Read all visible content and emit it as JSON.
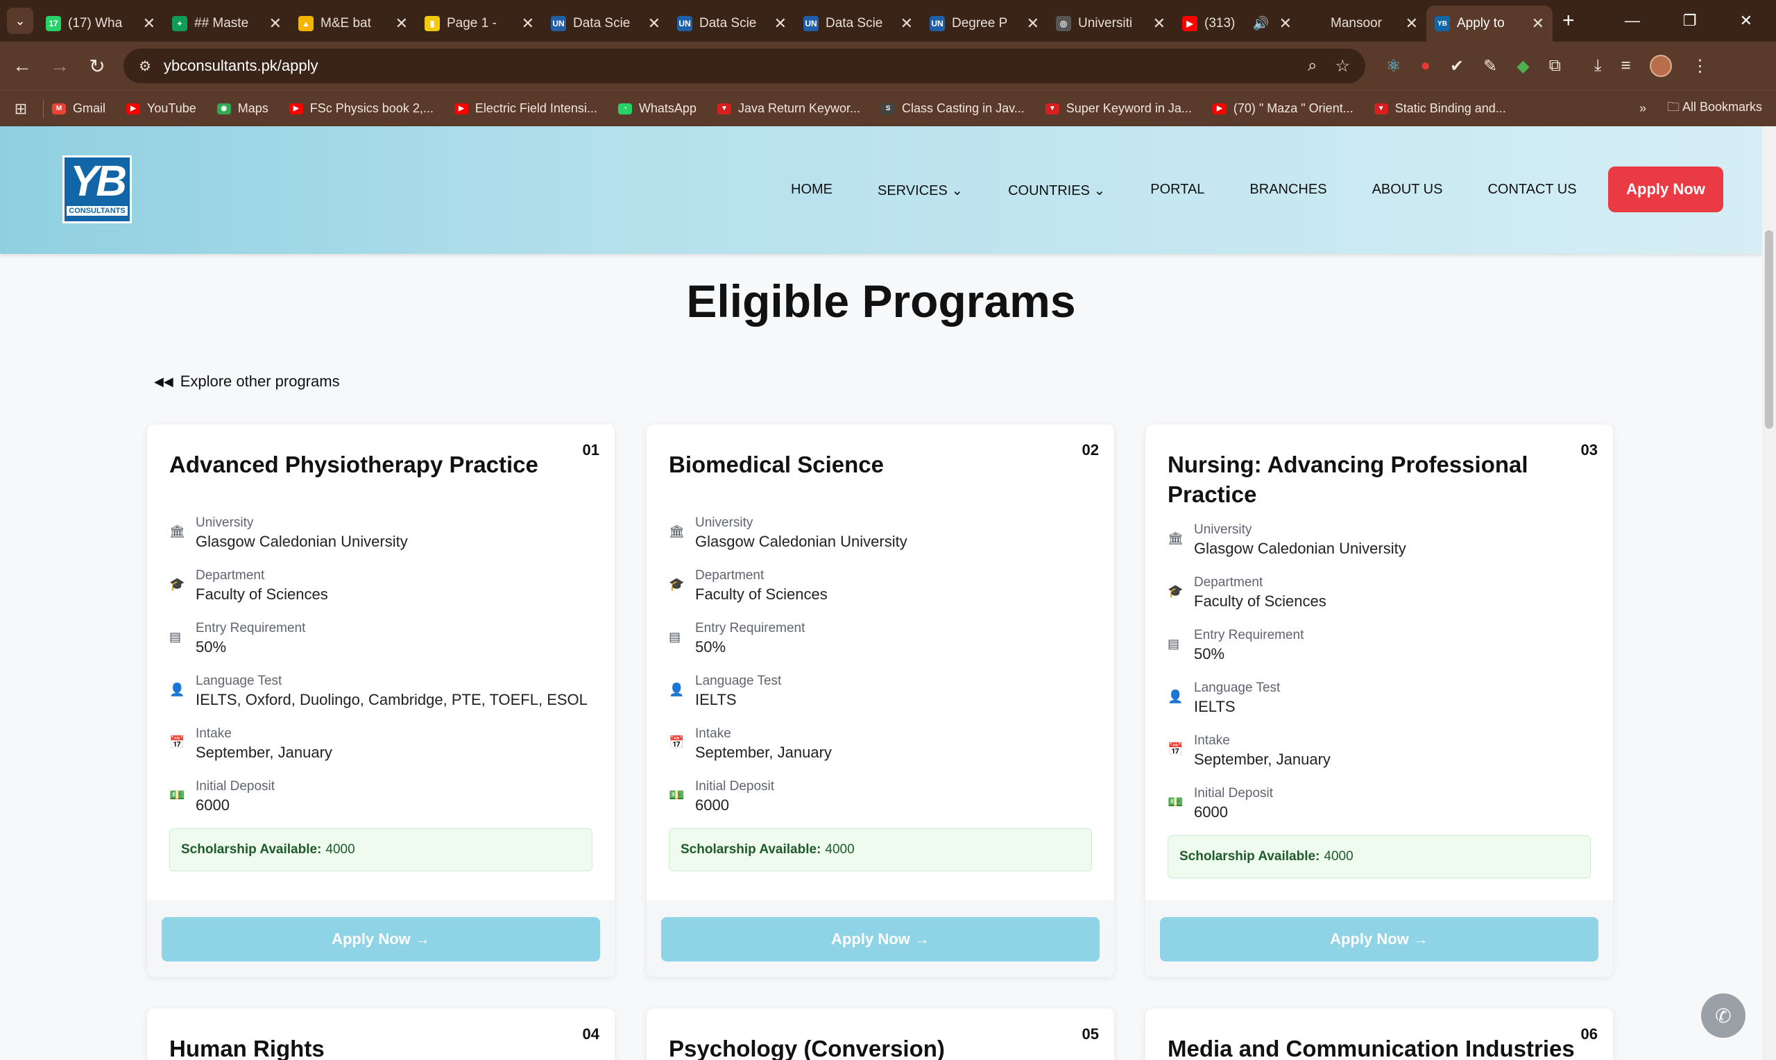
{
  "browser": {
    "tabs": [
      {
        "title": "(17) Wha",
        "fav_color": "#25d366",
        "fav": "17"
      },
      {
        "title": "## Maste",
        "fav_color": "#0f9d58",
        "fav": "+"
      },
      {
        "title": "M&E bat",
        "fav_color": "#f4b400",
        "fav": "▲"
      },
      {
        "title": "Page 1 - ",
        "fav_color": "#f2c811",
        "fav": "▮"
      },
      {
        "title": "Data Scie",
        "fav_color": "#1f5fa8",
        "fav": "UN"
      },
      {
        "title": "Data Scie",
        "fav_color": "#1f5fa8",
        "fav": "UN"
      },
      {
        "title": "Data Scie",
        "fav_color": "#1f5fa8",
        "fav": "UN"
      },
      {
        "title": "Degree P",
        "fav_color": "#1f5fa8",
        "fav": "UN"
      },
      {
        "title": "Universiti",
        "fav_color": "#555555",
        "fav": "◎"
      },
      {
        "title": "(313)",
        "fav_color": "#ff0000",
        "fav": "▶"
      },
      {
        "title": "Mansoor",
        "fav_color": "#3a2418",
        "fav": ""
      },
      {
        "title": "Apply to",
        "fav_color": "#1266a8",
        "fav": "YB"
      }
    ],
    "url": "ybconsultants.pk/apply",
    "bookmarks": [
      {
        "label": "Gmail",
        "color": "#ea4335",
        "icon": "M"
      },
      {
        "label": "YouTube",
        "color": "#ff0000",
        "icon": "▶"
      },
      {
        "label": "Maps",
        "color": "#34a853",
        "icon": "◉"
      },
      {
        "label": "FSc Physics book 2,...",
        "color": "#ff0000",
        "icon": "▶"
      },
      {
        "label": "Electric Field Intensi...",
        "color": "#ff0000",
        "icon": "▶"
      },
      {
        "label": "WhatsApp",
        "color": "#25d366",
        "icon": "◔"
      },
      {
        "label": "Java Return Keywor...",
        "color": "#d62020",
        "icon": "▼"
      },
      {
        "label": "Class Casting in Jav...",
        "color": "#444444",
        "icon": "S"
      },
      {
        "label": "Super Keyword in Ja...",
        "color": "#d62020",
        "icon": "▼"
      },
      {
        "label": "(70) \" Maza \" Orient...",
        "color": "#ff0000",
        "icon": "▶"
      },
      {
        "label": "Static Binding and...",
        "color": "#d62020",
        "icon": "▼"
      }
    ],
    "all_bookmarks": "All Bookmarks"
  },
  "site": {
    "logo": {
      "big": "YB",
      "small": "CONSULTANTS"
    },
    "nav": [
      "HOME",
      "SERVICES",
      "COUNTRIES",
      "PORTAL",
      "BRANCHES",
      "ABOUT US",
      "CONTACT US"
    ],
    "apply_button": "Apply Now"
  },
  "page": {
    "title": "Eligible Programs",
    "explore": "Explore other programs"
  },
  "labels": {
    "university": "University",
    "department": "Department",
    "entry": "Entry Requirement",
    "language": "Language Test",
    "intake": "Intake",
    "deposit": "Initial Deposit",
    "scholarship": "Scholarship Available:",
    "apply": "Apply Now"
  },
  "programs": [
    {
      "num": "01",
      "title": "Advanced Physiotherapy Practice",
      "university": "Glasgow Caledonian University",
      "department": "Faculty of Sciences",
      "entry": "50%",
      "language": "IELTS, Oxford, Duolingo, Cambridge, PTE, TOEFL, ESOL",
      "intake": "September, January",
      "deposit": "6000",
      "scholarship": "4000"
    },
    {
      "num": "02",
      "title": "Biomedical Science",
      "university": "Glasgow Caledonian University",
      "department": "Faculty of Sciences",
      "entry": "50%",
      "language": "IELTS",
      "intake": "September, January",
      "deposit": "6000",
      "scholarship": "4000"
    },
    {
      "num": "03",
      "title": "Nursing: Advancing Professional Practice",
      "university": "Glasgow Caledonian University",
      "department": "Faculty of Sciences",
      "entry": "50%",
      "language": "IELTS",
      "intake": "September, January",
      "deposit": "6000",
      "scholarship": "4000"
    },
    {
      "num": "04",
      "title": "Human Rights"
    },
    {
      "num": "05",
      "title": "Psychology (Conversion)"
    },
    {
      "num": "06",
      "title": "Media and Communication Industries"
    }
  ]
}
